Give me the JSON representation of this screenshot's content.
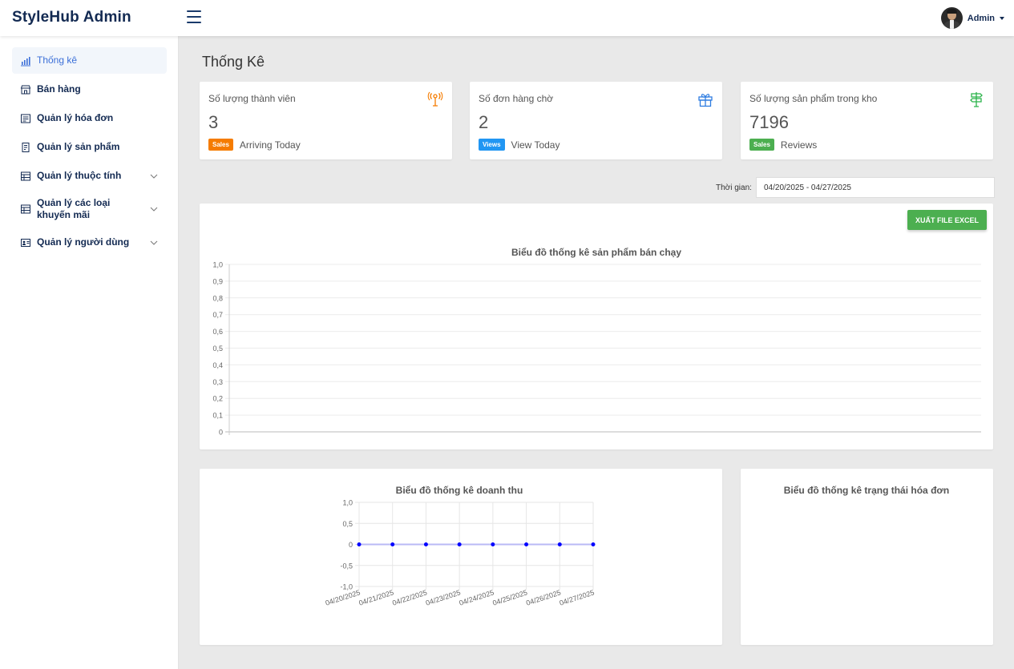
{
  "app": {
    "brand": "StyleHub Admin",
    "user_name": "Admin"
  },
  "sidebar": {
    "items": [
      {
        "label": "Thống kê",
        "icon": "bar-chart-icon",
        "active": true
      },
      {
        "label": "Bán hàng",
        "icon": "store-icon"
      },
      {
        "label": "Quản lý hóa đơn",
        "icon": "invoice-icon"
      },
      {
        "label": "Quản lý sản phẩm",
        "icon": "product-icon"
      },
      {
        "label": "Quản lý thuộc tính",
        "icon": "table-icon",
        "expandable": true
      },
      {
        "label": "Quản lý các loại khuyến mãi",
        "icon": "table-icon",
        "expandable": true
      },
      {
        "label": "Quản lý người dùng",
        "icon": "id-card-icon",
        "expandable": true
      }
    ]
  },
  "page": {
    "title": "Thống Kê"
  },
  "stats": [
    {
      "label": "Số lượng thành viên",
      "value": "3",
      "badge": "Sales",
      "badge_color": "#f57c00",
      "foot": "Arriving Today",
      "icon": "antenna-icon",
      "icon_color": "#f57c00"
    },
    {
      "label": "Số đơn hàng chờ",
      "value": "2",
      "badge": "Views",
      "badge_color": "#2196f3",
      "foot": "View Today",
      "icon": "gift-icon",
      "icon_color": "#2f7de1"
    },
    {
      "label": "Số lượng sản phẩm trong kho",
      "value": "7196",
      "badge": "Sales",
      "badge_color": "#4caf50",
      "foot": "Reviews",
      "icon": "signpost-icon",
      "icon_color": "#2bb34a"
    }
  ],
  "filter": {
    "label": "Thời gian:",
    "value": "04/20/2025 - 04/27/2025"
  },
  "export_button": "XUẤT FILE EXCEL",
  "chart_data": [
    {
      "type": "bar",
      "title": "Biểu đồ thống kê sản phẩm bán chạy",
      "categories": [],
      "series": [],
      "ylim": [
        0,
        1
      ],
      "yticks": [
        "1,0",
        "0,9",
        "0,8",
        "0,7",
        "0,6",
        "0,5",
        "0,4",
        "0,3",
        "0,2",
        "0,1",
        "0"
      ],
      "grid": true
    },
    {
      "type": "line",
      "title": "Biểu đồ thống kê doanh thu",
      "x": [
        "04/20/2025",
        "04/21/2025",
        "04/22/2025",
        "04/23/2025",
        "04/24/2025",
        "04/25/2025",
        "04/26/2025",
        "04/27/2025"
      ],
      "series": [
        {
          "values": [
            0,
            0,
            0,
            0,
            0,
            0,
            0,
            0
          ],
          "color": "#0000ff"
        }
      ],
      "ylim": [
        -1,
        1
      ],
      "yticks": [
        "1,0",
        "0,5",
        "0",
        "-0,5",
        "-1,0"
      ],
      "grid": true
    },
    {
      "type": "pie",
      "title": "Biểu đồ thống kê trạng thái hóa đơn",
      "categories": [],
      "values": []
    }
  ]
}
